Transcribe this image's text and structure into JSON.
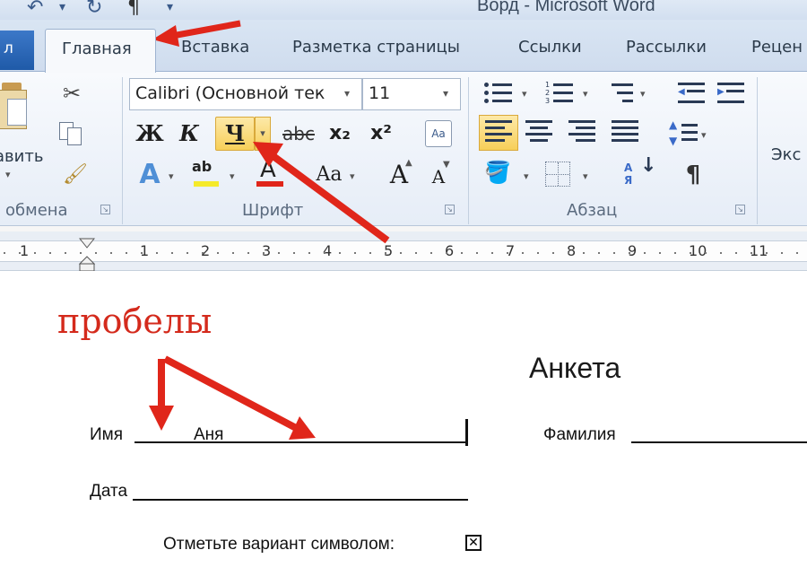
{
  "window": {
    "title": "Ворд - Microsoft Word"
  },
  "tabs": {
    "file": "л",
    "items": [
      "Главная",
      "Вставка",
      "Разметка страницы",
      "Ссылки",
      "Рассылки",
      "Рецен"
    ]
  },
  "ribbon": {
    "clipboard": {
      "paste_label": "авить",
      "group_label": "обмена"
    },
    "font": {
      "font_name": "Calibri (Основной тек",
      "font_size": "11",
      "bold": "Ж",
      "italic": "К",
      "underline": "Ч",
      "strike": "abc",
      "subscript": "x₂",
      "superscript": "x²",
      "group_label": "Шрифт",
      "grow": "A",
      "shrink": "A",
      "change_case": "Aa",
      "text_effects": "A",
      "highlight": "ab",
      "font_color": "A"
    },
    "paragraph": {
      "group_label": "Абзац",
      "show_marks": "¶",
      "sort": "А Я"
    },
    "styles": {
      "partial_label": "Экс"
    }
  },
  "ruler": {
    "numbers": [
      "1",
      "1",
      "2",
      "3",
      "4",
      "5",
      "6",
      "7",
      "8",
      "9",
      "10",
      "11"
    ]
  },
  "annotation": {
    "text": "пробелы"
  },
  "document": {
    "title": "Анкета",
    "name_label": "Имя",
    "name_value": "Аня",
    "surname_label": "Фамилия",
    "date_label": "Дата",
    "choice_label": "Отметьте вариант символом:",
    "checkbox_glyph": "✕"
  },
  "colors": {
    "arrow": "#e0261a",
    "active_button": "#f7cf59",
    "file_tab": "#2a66b8"
  }
}
